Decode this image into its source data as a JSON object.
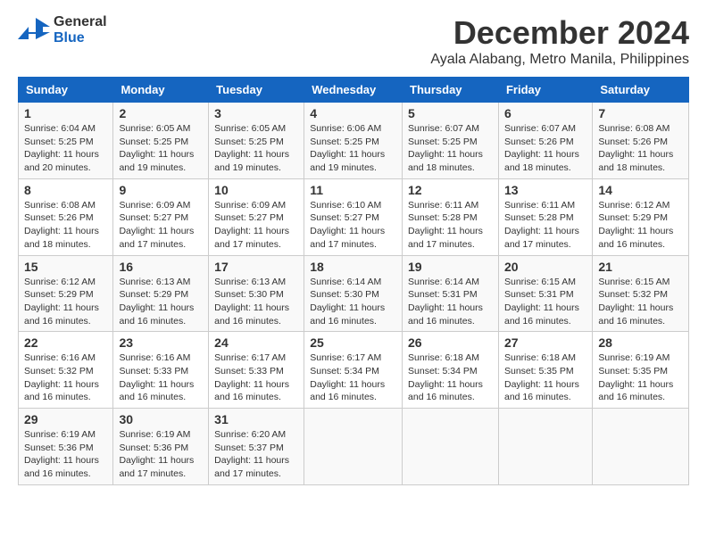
{
  "logo": {
    "text_general": "General",
    "text_blue": "Blue"
  },
  "title": {
    "month": "December 2024",
    "location": "Ayala Alabang, Metro Manila, Philippines"
  },
  "calendar": {
    "headers": [
      "Sunday",
      "Monday",
      "Tuesday",
      "Wednesday",
      "Thursday",
      "Friday",
      "Saturday"
    ],
    "weeks": [
      [
        null,
        null,
        null,
        null,
        null,
        null,
        null
      ]
    ],
    "days": {
      "1": {
        "sunrise": "6:04 AM",
        "sunset": "5:25 PM",
        "daylight": "11 hours and 20 minutes"
      },
      "2": {
        "sunrise": "6:05 AM",
        "sunset": "5:25 PM",
        "daylight": "11 hours and 19 minutes"
      },
      "3": {
        "sunrise": "6:05 AM",
        "sunset": "5:25 PM",
        "daylight": "11 hours and 19 minutes"
      },
      "4": {
        "sunrise": "6:06 AM",
        "sunset": "5:25 PM",
        "daylight": "11 hours and 19 minutes"
      },
      "5": {
        "sunrise": "6:07 AM",
        "sunset": "5:25 PM",
        "daylight": "11 hours and 18 minutes"
      },
      "6": {
        "sunrise": "6:07 AM",
        "sunset": "5:26 PM",
        "daylight": "11 hours and 18 minutes"
      },
      "7": {
        "sunrise": "6:08 AM",
        "sunset": "5:26 PM",
        "daylight": "11 hours and 18 minutes"
      },
      "8": {
        "sunrise": "6:08 AM",
        "sunset": "5:26 PM",
        "daylight": "11 hours and 18 minutes"
      },
      "9": {
        "sunrise": "6:09 AM",
        "sunset": "5:27 PM",
        "daylight": "11 hours and 17 minutes"
      },
      "10": {
        "sunrise": "6:09 AM",
        "sunset": "5:27 PM",
        "daylight": "11 hours and 17 minutes"
      },
      "11": {
        "sunrise": "6:10 AM",
        "sunset": "5:27 PM",
        "daylight": "11 hours and 17 minutes"
      },
      "12": {
        "sunrise": "6:11 AM",
        "sunset": "5:28 PM",
        "daylight": "11 hours and 17 minutes"
      },
      "13": {
        "sunrise": "6:11 AM",
        "sunset": "5:28 PM",
        "daylight": "11 hours and 17 minutes"
      },
      "14": {
        "sunrise": "6:12 AM",
        "sunset": "5:29 PM",
        "daylight": "11 hours and 16 minutes"
      },
      "15": {
        "sunrise": "6:12 AM",
        "sunset": "5:29 PM",
        "daylight": "11 hours and 16 minutes"
      },
      "16": {
        "sunrise": "6:13 AM",
        "sunset": "5:29 PM",
        "daylight": "11 hours and 16 minutes"
      },
      "17": {
        "sunrise": "6:13 AM",
        "sunset": "5:30 PM",
        "daylight": "11 hours and 16 minutes"
      },
      "18": {
        "sunrise": "6:14 AM",
        "sunset": "5:30 PM",
        "daylight": "11 hours and 16 minutes"
      },
      "19": {
        "sunrise": "6:14 AM",
        "sunset": "5:31 PM",
        "daylight": "11 hours and 16 minutes"
      },
      "20": {
        "sunrise": "6:15 AM",
        "sunset": "5:31 PM",
        "daylight": "11 hours and 16 minutes"
      },
      "21": {
        "sunrise": "6:15 AM",
        "sunset": "5:32 PM",
        "daylight": "11 hours and 16 minutes"
      },
      "22": {
        "sunrise": "6:16 AM",
        "sunset": "5:32 PM",
        "daylight": "11 hours and 16 minutes"
      },
      "23": {
        "sunrise": "6:16 AM",
        "sunset": "5:33 PM",
        "daylight": "11 hours and 16 minutes"
      },
      "24": {
        "sunrise": "6:17 AM",
        "sunset": "5:33 PM",
        "daylight": "11 hours and 16 minutes"
      },
      "25": {
        "sunrise": "6:17 AM",
        "sunset": "5:34 PM",
        "daylight": "11 hours and 16 minutes"
      },
      "26": {
        "sunrise": "6:18 AM",
        "sunset": "5:34 PM",
        "daylight": "11 hours and 16 minutes"
      },
      "27": {
        "sunrise": "6:18 AM",
        "sunset": "5:35 PM",
        "daylight": "11 hours and 16 minutes"
      },
      "28": {
        "sunrise": "6:19 AM",
        "sunset": "5:35 PM",
        "daylight": "11 hours and 16 minutes"
      },
      "29": {
        "sunrise": "6:19 AM",
        "sunset": "5:36 PM",
        "daylight": "11 hours and 16 minutes"
      },
      "30": {
        "sunrise": "6:19 AM",
        "sunset": "5:36 PM",
        "daylight": "11 hours and 17 minutes"
      },
      "31": {
        "sunrise": "6:20 AM",
        "sunset": "5:37 PM",
        "daylight": "11 hours and 17 minutes"
      }
    }
  }
}
